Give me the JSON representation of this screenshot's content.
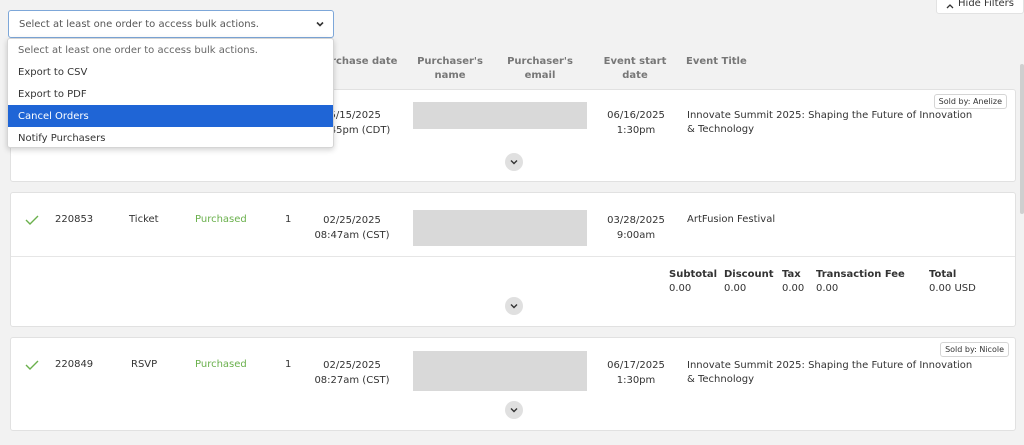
{
  "bulk": {
    "selected": "Select at least one order to access bulk actions.",
    "options": [
      "Select at least one order to access bulk actions.",
      "Export to CSV",
      "Export to PDF",
      "Cancel Orders",
      "Notify Purchasers"
    ],
    "highlighted_index": 3
  },
  "hide_filters_label": "Hide Filters",
  "columns": {
    "purchase_date": "Purchase date",
    "purchasers_name_1": "Purchaser's",
    "purchasers_name_2": "name",
    "purchasers_email_1": "Purchaser's",
    "purchasers_email_2": "email",
    "event_start_date": "Event start date",
    "event_title": "Event Title"
  },
  "orders": [
    {
      "purchase_date": "05/15/2025",
      "purchase_time": "12:45pm (CDT)",
      "event_date": "06/16/2025",
      "event_time": "1:30pm",
      "event_title": "Innovate Summit 2025: Shaping the Future of Innovation & Technology",
      "sold_by": "Sold by: Anelize"
    },
    {
      "id": "220853",
      "type": "Ticket",
      "status": "Purchased",
      "qty": "1",
      "purchase_date": "02/25/2025",
      "purchase_time": "08:47am (CST)",
      "event_date": "03/28/2025",
      "event_time": "9:00am",
      "event_title": "ArtFusion Festival",
      "totals": {
        "subtotal_label": "Subtotal",
        "subtotal": "0.00",
        "discount_label": "Discount",
        "discount": "0.00",
        "tax_label": "Tax",
        "tax": "0.00",
        "fee_label": "Transaction Fee",
        "fee": "0.00",
        "total_label": "Total",
        "total": "0.00 USD"
      }
    },
    {
      "id": "220849",
      "type": "RSVP",
      "status": "Purchased",
      "qty": "1",
      "purchase_date": "02/25/2025",
      "purchase_time": "08:27am (CST)",
      "event_date": "06/17/2025",
      "event_time": "1:30pm",
      "event_title": "Innovate Summit 2025: Shaping the Future of Innovation & Technology",
      "sold_by": "Sold by: Nicole"
    }
  ],
  "colors": {
    "accent": "#1f65d6",
    "purchased": "#6ab04c",
    "redacted": "#d9d9d9"
  }
}
